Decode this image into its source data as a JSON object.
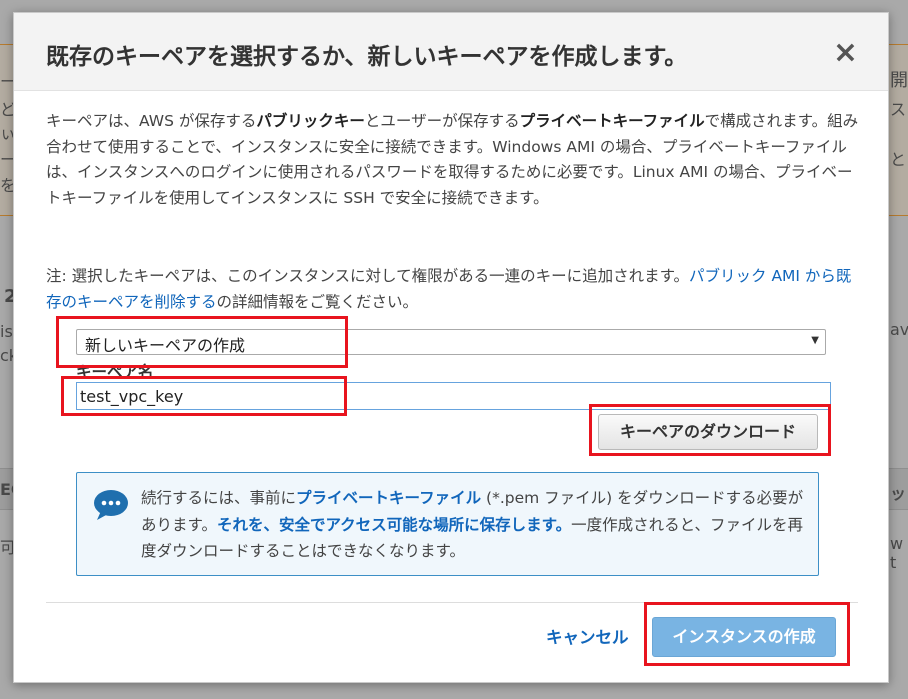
{
  "background": {
    "fragments": [
      "ー",
      "ど",
      "ぃ",
      "ー",
      "を",
      "2",
      "is",
      "ck",
      "EC",
      "可",
      "開",
      "ス",
      "と",
      "ava",
      "ッ",
      "w t"
    ]
  },
  "modal": {
    "title": "既存のキーペアを選択するか、新しいキーペアを作成します。",
    "close_label": "×",
    "description": {
      "p1_a": "キーペアは、AWS が保存する",
      "p1_b": "パブリックキー",
      "p1_c": "とユーザーが保存する",
      "p1_d": "プライベートキーファイル",
      "p1_e": "で構成されます。組み合わせて使用することで、インスタンスに安全に接続できます。Windows AMI の場合、プライベートキーファイルは、インスタンスへのログインに使用されるパスワードを取得するために必要です。Linux AMI の場合、プライベートキーファイルを使用してインスタンスに SSH で安全に接続できます。"
    },
    "note": {
      "prefix": "注: 選択したキーペアは、このインスタンスに対して権限がある一連のキーに追加されます。",
      "link": "パブリック AMI から既存のキーペアを削除する",
      "suffix": "の詳細情報をご覧ください。"
    },
    "keypair_select": {
      "value": "新しいキーペアの作成"
    },
    "keypair_name": {
      "label": "キーペア名",
      "value": "test_vpc_key"
    },
    "download_button": "キーペアのダウンロード",
    "info": {
      "a": "続行するには、事前に",
      "b": "プライベートキーファイル",
      "c": " (*.pem ファイル) をダウンロードする必要があります。",
      "d": "それを、安全でアクセス可能な場所に保存します。",
      "e": "一度作成されると、ファイルを再度ダウンロードすることはできなくなります。"
    },
    "cancel_label": "キャンセル",
    "create_button": "インスタンスの作成"
  },
  "colors": {
    "annotation": "#e8141e",
    "link": "#1166bb",
    "primary_button": "#79b4e3",
    "info_border": "#3d8fc6"
  }
}
